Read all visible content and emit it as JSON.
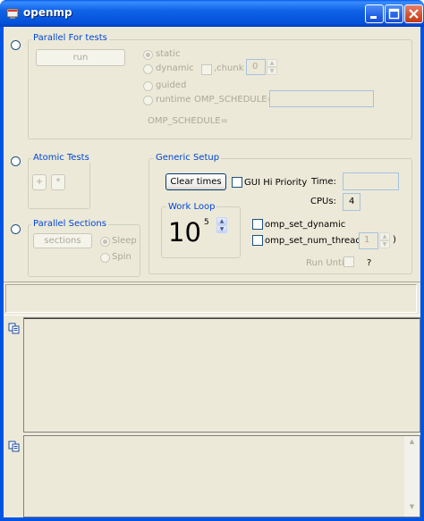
{
  "window": {
    "title": "openmp"
  },
  "parallel_for": {
    "label": "Parallel For tests",
    "run_button": "run",
    "schedules": [
      {
        "label": "static",
        "selected": true
      },
      {
        "label": "dynamic",
        "selected": false
      },
      {
        "label": "guided",
        "selected": false
      },
      {
        "label": "runtime",
        "selected": false
      }
    ],
    "chunk_label": ",chunk",
    "chunk_value": "0",
    "omp_schedule_input_label": "OMP_SCHEDULE=",
    "omp_schedule_value": "",
    "omp_schedule_status": "OMP_SCHEDULE="
  },
  "atomic": {
    "label": "Atomic Tests",
    "plus_button": "+",
    "times_button": "*"
  },
  "parallel_sections": {
    "label": "Parallel Sections",
    "sections_button": "sections",
    "options": [
      {
        "label": "Sleep",
        "selected": true
      },
      {
        "label": "Spin",
        "selected": false
      }
    ]
  },
  "generic_setup": {
    "label": "Generic Setup",
    "clear_times_button": "Clear times",
    "gui_hi_priority_label": "GUI Hi Priority",
    "time_label": "Time:",
    "time_value": "",
    "cpus_label": "CPUs:",
    "cpus_value": "4",
    "work_loop": {
      "label": "Work Loop",
      "base": "10",
      "exponent": "5"
    },
    "omp_set_dynamic_label": "omp_set_dynamic",
    "omp_set_num_threads_label": "omp_set_num_threads(",
    "num_threads_value": "1",
    "num_threads_close": ")",
    "run_until_label": "Run Until",
    "question_label": "?"
  }
}
